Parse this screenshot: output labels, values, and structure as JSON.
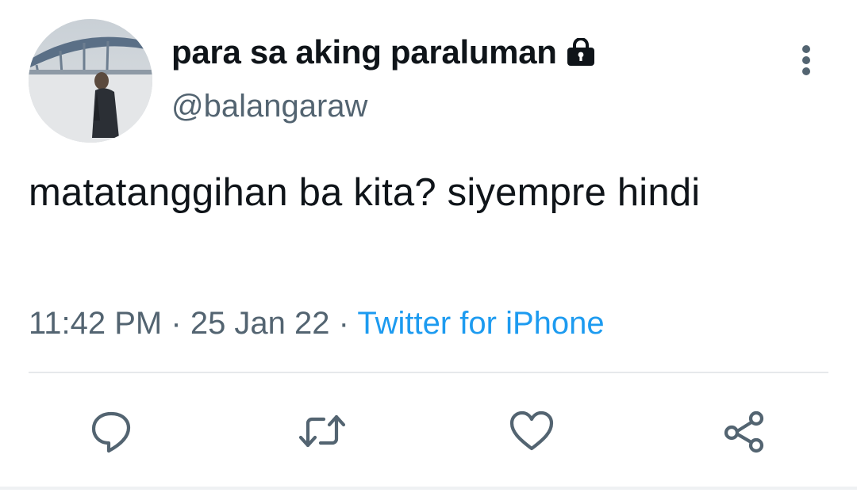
{
  "tweet": {
    "display_name": "para sa aking paraluman",
    "handle": "@balangaraw",
    "text": "matatanggihan ba kita? siyempre hindi",
    "time": "11:42 PM",
    "separator": "·",
    "date": "25 Jan 22",
    "source": "Twitter for iPhone",
    "protected": true
  },
  "icons": {
    "lock": "lock-icon",
    "more": "vertical-ellipsis-icon",
    "reply": "speech-bubble-icon",
    "retweet": "retweet-arrows-icon",
    "like": "heart-icon",
    "share": "share-nodes-icon"
  },
  "colors": {
    "text_primary": "#0f1419",
    "text_secondary": "#536471",
    "link": "#1d9bf0",
    "divider": "#e6e9eb"
  }
}
